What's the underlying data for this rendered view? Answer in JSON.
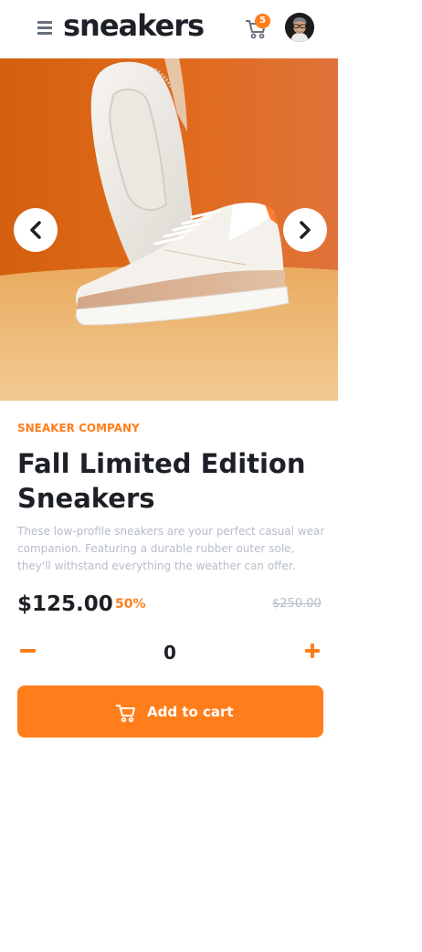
{
  "header": {
    "logo": "sneakers",
    "cart_count": "5"
  },
  "gallery": {
    "image_subject": "white and tan leather sneakers on orange backdrop",
    "prev_icon": "chevron-left-icon",
    "next_icon": "chevron-right-icon"
  },
  "product": {
    "company": "SNEAKER COMPANY",
    "title": "Fall Limited Edition Sneakers",
    "description": "These low-profile sneakers are your perfect casual wear companion. Featuring a durable rubber outer sole, they'll withstand everything the weather can offer.",
    "price": "$125.00",
    "discount": "50%",
    "old_price": "$250.00"
  },
  "quantity": {
    "value": "0",
    "minus_icon": "minus-icon",
    "plus_icon": "plus-icon"
  },
  "actions": {
    "add_to_cart": "Add to cart"
  },
  "colors": {
    "accent": "#ff7e1b",
    "heading": "#1d2026",
    "muted": "#b6bcc8",
    "icon_gray": "#68707d"
  }
}
